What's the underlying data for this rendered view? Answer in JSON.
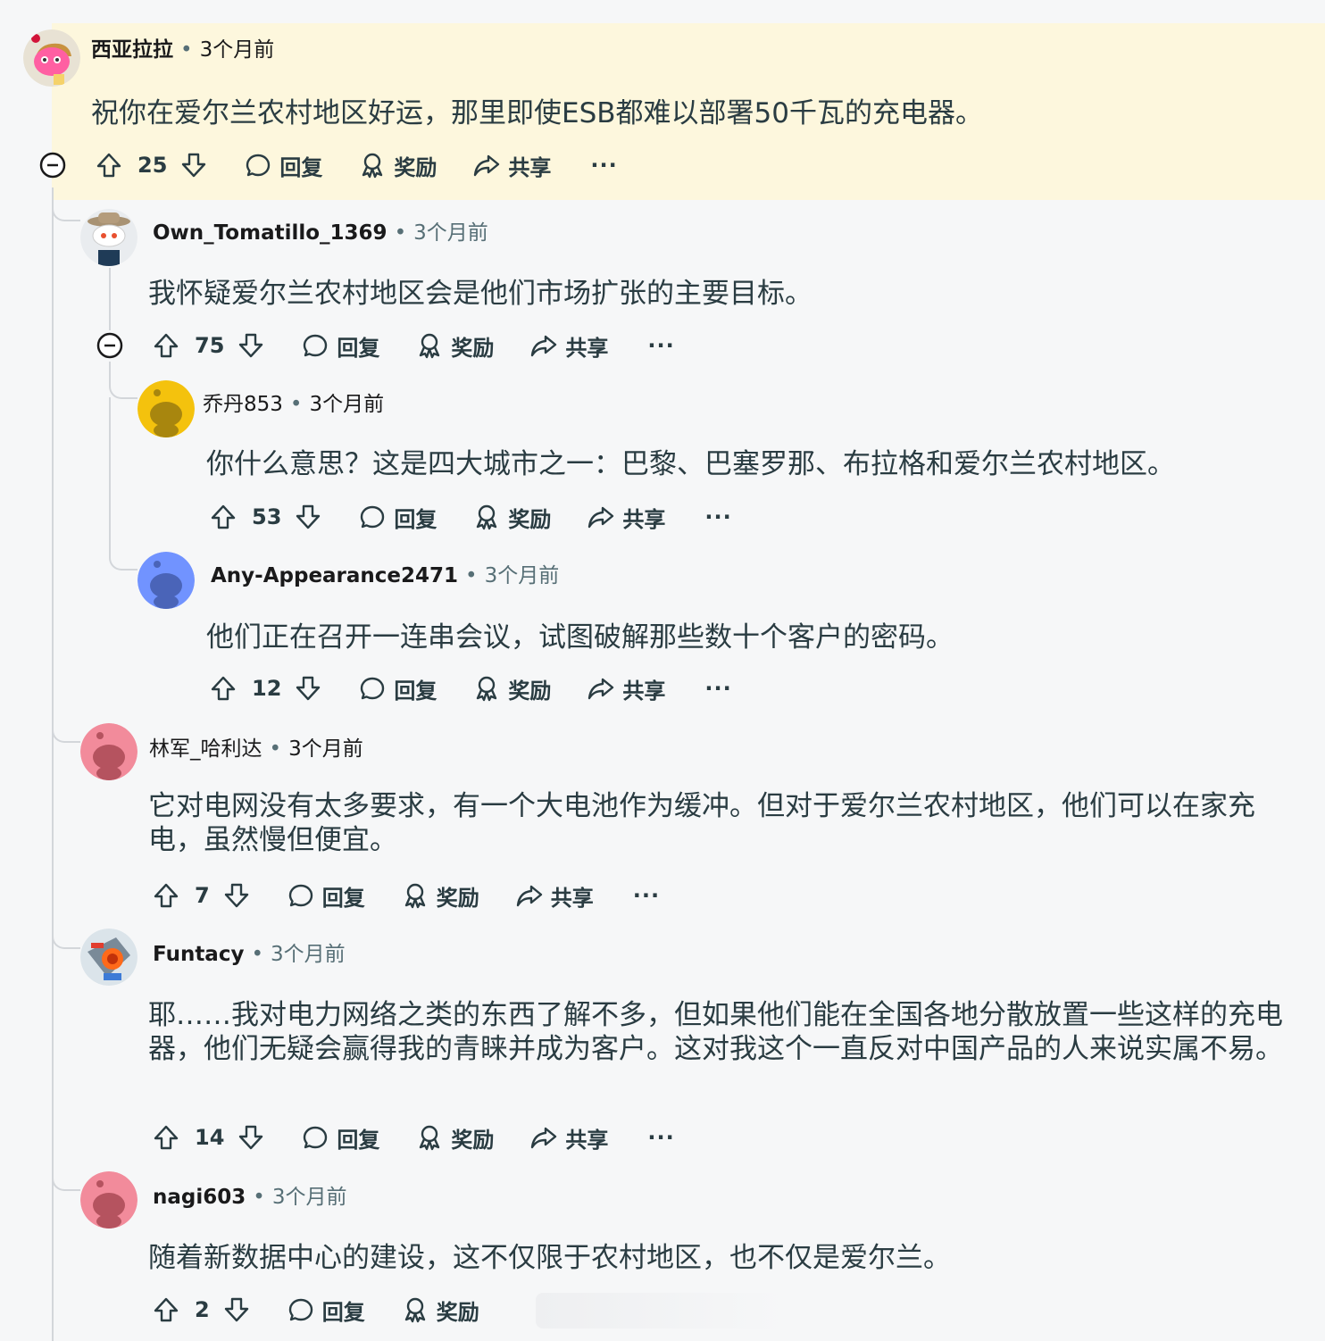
{
  "comments": [
    {
      "user": "西亚拉拉",
      "time": "3个月前",
      "text": "祝你在爱尔兰农村地区好运，那里即使ESB都难以部署50千瓦的充电器。",
      "score": "25",
      "reply": "回复",
      "award": "奖励",
      "share": "共享",
      "more": "···"
    },
    {
      "user": "Own_Tomatillo_1369",
      "time": "3个月前",
      "text": "我怀疑爱尔兰农村地区会是他们市场扩张的主要目标。",
      "score": "75",
      "reply": "回复",
      "award": "奖励",
      "share": "共享",
      "more": "···"
    },
    {
      "user": "乔丹853",
      "time": "3个月前",
      "text": "你什么意思？这是四大城市之一：巴黎、巴塞罗那、布拉格和爱尔兰农村地区。",
      "score": "53",
      "reply": "回复",
      "award": "奖励",
      "share": "共享",
      "more": "···"
    },
    {
      "user": "Any-Appearance2471",
      "time": "3个月前",
      "text": "他们正在召开一连串会议，试图破解那些数十个客户的密码。",
      "score": "12",
      "reply": "回复",
      "award": "奖励",
      "share": "共享",
      "more": "···"
    },
    {
      "user": "林军_哈利达",
      "time": "3个月前",
      "text": "它对电网没有太多要求，有一个大电池作为缓冲。但对于爱尔兰农村地区，他们可以在家充电，虽然慢但便宜。",
      "score": "7",
      "reply": "回复",
      "award": "奖励",
      "share": "共享",
      "more": "···"
    },
    {
      "user": "Funtacy",
      "time": "3个月前",
      "text": "耶……我对电力网络之类的东西了解不多，但如果他们能在全国各地分散放置一些这样的充电器，他们无疑会赢得我的青睐并成为客户。这对我这个一直反对中国产品的人来说实属不易。",
      "score": "14",
      "reply": "回复",
      "award": "奖励",
      "share": "共享",
      "more": "···"
    },
    {
      "user": "nagi603",
      "time": "3个月前",
      "text": "随着新数据中心的建设，这不仅限于农村地区，也不仅是爱尔兰。",
      "score": "2",
      "reply": "回复",
      "award": "奖励"
    }
  ],
  "separator": "•",
  "colors": {
    "highlight": "#fdf7dd",
    "background": "#f6f7f8",
    "thread": "#d3d6da",
    "text": "#2a3c42",
    "meta": "#576f76"
  }
}
